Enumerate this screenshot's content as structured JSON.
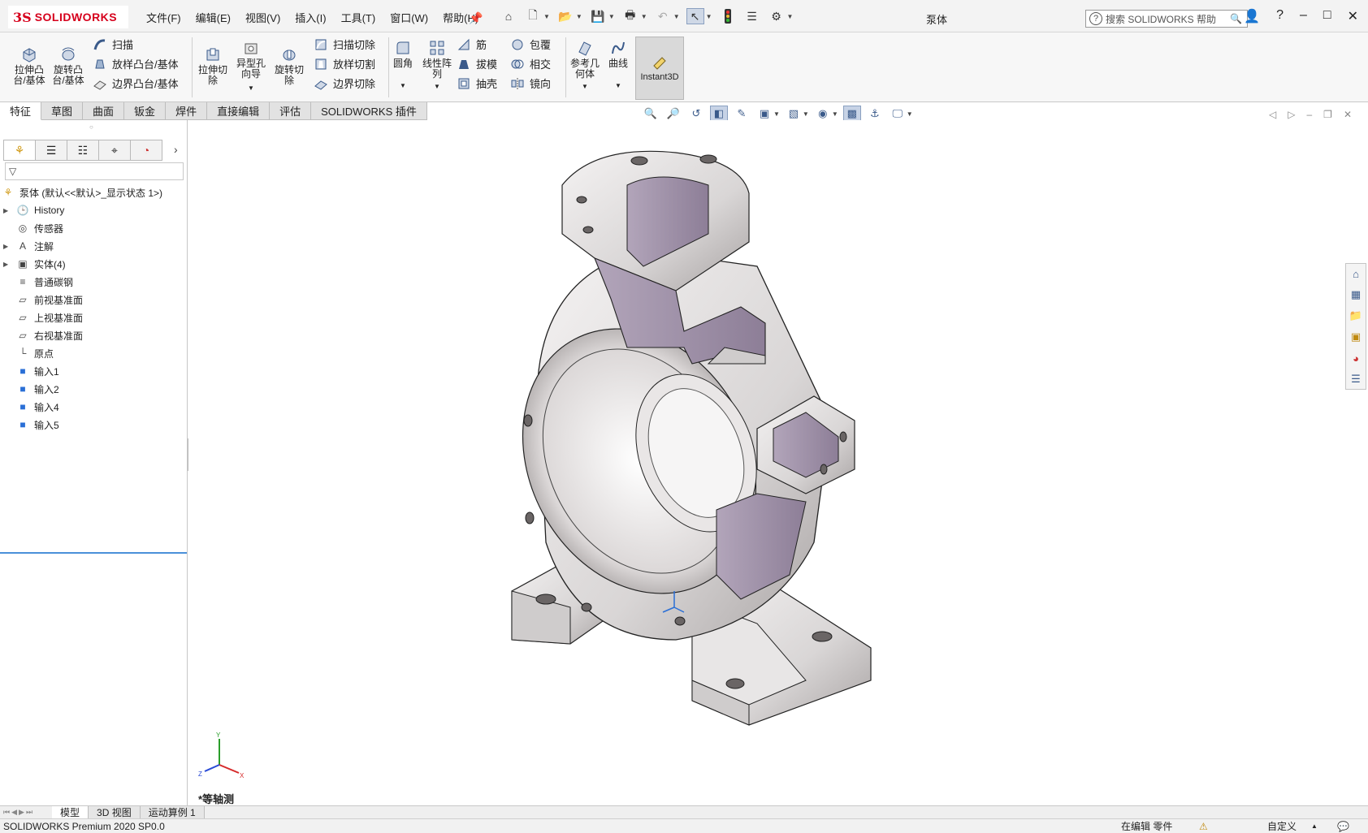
{
  "app": {
    "logo_ds": "3S",
    "logo_name": "SOLIDWORKS",
    "document_title": "泵体"
  },
  "menu": [
    "文件(F)",
    "编辑(E)",
    "视图(V)",
    "插入(I)",
    "工具(T)",
    "窗口(W)",
    "帮助(H)"
  ],
  "search": {
    "placeholder": "搜索 SOLIDWORKS 帮助"
  },
  "ribbon": {
    "extrude_boss": "拉伸凸\n台/基体",
    "revolve_boss": "旋转凸\n台/基体",
    "sweep": "扫描",
    "loft_boss": "放样凸台/基体",
    "boundary_boss": "边界凸台/基体",
    "extrude_cut": "拉伸切\n除",
    "hole_wizard": "异型孔\n向导",
    "revolve_cut": "旋转切\n除",
    "swept_cut": "扫描切除",
    "lofted_cut": "放样切割",
    "boundary_cut": "边界切除",
    "fillet": "圆角",
    "linear_pattern": "线性阵\n列",
    "rib": "筋",
    "draft": "拔模",
    "shell": "抽壳",
    "wrap": "包覆",
    "intersect": "相交",
    "mirror": "镜向",
    "ref_geometry": "参考几\n何体",
    "curves": "曲线",
    "instant3d": "Instant3D"
  },
  "tabs": [
    "特征",
    "草图",
    "曲面",
    "钣金",
    "焊件",
    "直接编辑",
    "评估",
    "SOLIDWORKS 插件"
  ],
  "tree": {
    "root": "泵体  (默认<<默认>_显示状态 1>)",
    "items": [
      {
        "label": "History",
        "expandable": true
      },
      {
        "label": "传感器",
        "expandable": false
      },
      {
        "label": "注解",
        "expandable": true
      },
      {
        "label": "实体(4)",
        "expandable": true
      },
      {
        "label": "普通碳钢",
        "expandable": false
      },
      {
        "label": "前视基准面",
        "expandable": false
      },
      {
        "label": "上视基准面",
        "expandable": false
      },
      {
        "label": "右视基准面",
        "expandable": false
      },
      {
        "label": "原点",
        "expandable": false
      },
      {
        "label": "输入1",
        "expandable": false
      },
      {
        "label": "输入2",
        "expandable": false
      },
      {
        "label": "输入4",
        "expandable": false
      },
      {
        "label": "输入5",
        "expandable": false
      }
    ]
  },
  "viewport": {
    "view_label": "*等轴测",
    "triad": {
      "x": "X",
      "y": "Y",
      "z": "Z"
    }
  },
  "bottom_tabs": [
    "模型",
    "3D 视图",
    "运动算例 1"
  ],
  "status": {
    "version": "SOLIDWORKS Premium 2020 SP0.0",
    "editing": "在编辑 零件",
    "custom": "自定义"
  },
  "colors": {
    "brand": "#d6001c",
    "accent": "#2a6fd6",
    "model_surface": "#e6e3e3",
    "model_cut": "#9a8ba3"
  }
}
